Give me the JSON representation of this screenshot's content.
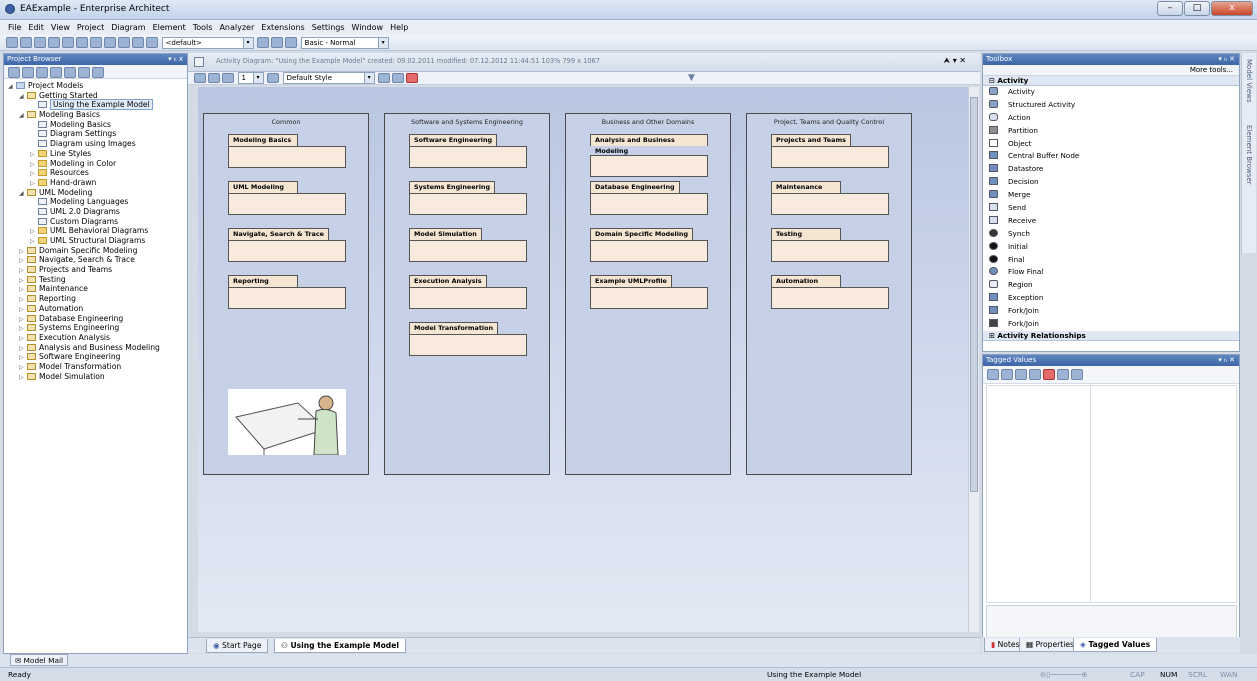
{
  "window": {
    "title": "EAExample - Enterprise Architect",
    "buttons": [
      "–",
      "□",
      "x"
    ]
  },
  "menu": [
    "File",
    "Edit",
    "View",
    "Project",
    "Diagram",
    "Element",
    "Tools",
    "Analyzer",
    "Extensions",
    "Settings",
    "Window",
    "Help"
  ],
  "toolbar": {
    "view_combo": "<default>",
    "workspace_combo": "Basic - Normal"
  },
  "project_browser": {
    "title": "Project Browser",
    "controls": "▾ ₕ x",
    "tree": [
      {
        "label": "Project Models",
        "depth": 0,
        "arrow": "◢",
        "icon": "model"
      },
      {
        "label": "Getting Started",
        "depth": 1,
        "arrow": "◢",
        "icon": "pkg"
      },
      {
        "label": "Using the Example Model",
        "depth": 2,
        "arrow": "",
        "icon": "diag",
        "selected": true
      },
      {
        "label": "Modeling Basics",
        "depth": 1,
        "arrow": "◢",
        "icon": "pkg"
      },
      {
        "label": "Modeling Basics",
        "depth": 2,
        "arrow": "",
        "icon": "diag"
      },
      {
        "label": "Diagram Settings",
        "depth": 2,
        "arrow": "",
        "icon": "diag"
      },
      {
        "label": "Diagram using Images",
        "depth": 2,
        "arrow": "",
        "icon": "diag"
      },
      {
        "label": "Line Styles",
        "depth": 2,
        "arrow": "▷",
        "icon": "folder"
      },
      {
        "label": "Modeling in Color",
        "depth": 2,
        "arrow": "▷",
        "icon": "folder"
      },
      {
        "label": "Resources",
        "depth": 2,
        "arrow": "▷",
        "icon": "folder"
      },
      {
        "label": "Hand-drawn",
        "depth": 2,
        "arrow": "▷",
        "icon": "folder"
      },
      {
        "label": "UML Modeling",
        "depth": 1,
        "arrow": "◢",
        "icon": "pkg"
      },
      {
        "label": "Modeling Languages",
        "depth": 2,
        "arrow": "",
        "icon": "diag"
      },
      {
        "label": "UML 2.0 Diagrams",
        "depth": 2,
        "arrow": "",
        "icon": "diag"
      },
      {
        "label": "Custom Diagrams",
        "depth": 2,
        "arrow": "",
        "icon": "diag"
      },
      {
        "label": "UML Behavioral Diagrams",
        "depth": 2,
        "arrow": "▷",
        "icon": "folder"
      },
      {
        "label": "UML Structural Diagrams",
        "depth": 2,
        "arrow": "▷",
        "icon": "folder"
      },
      {
        "label": "Domain Specific Modeling",
        "depth": 1,
        "arrow": "▷",
        "icon": "pkg"
      },
      {
        "label": "Navigate, Search & Trace",
        "depth": 1,
        "arrow": "▷",
        "icon": "pkg"
      },
      {
        "label": "Projects and Teams",
        "depth": 1,
        "arrow": "▷",
        "icon": "pkg"
      },
      {
        "label": "Testing",
        "depth": 1,
        "arrow": "▷",
        "icon": "pkg"
      },
      {
        "label": "Maintenance",
        "depth": 1,
        "arrow": "▷",
        "icon": "pkg"
      },
      {
        "label": "Reporting",
        "depth": 1,
        "arrow": "▷",
        "icon": "pkg"
      },
      {
        "label": "Automation",
        "depth": 1,
        "arrow": "▷",
        "icon": "pkg"
      },
      {
        "label": "Database Engineering",
        "depth": 1,
        "arrow": "▷",
        "icon": "pkg"
      },
      {
        "label": "Systems Engineering",
        "depth": 1,
        "arrow": "▷",
        "icon": "pkg"
      },
      {
        "label": "Execution Analysis",
        "depth": 1,
        "arrow": "▷",
        "icon": "pkg"
      },
      {
        "label": "Analysis and Business Modeling",
        "depth": 1,
        "arrow": "▷",
        "icon": "pkg"
      },
      {
        "label": "Software Engineering",
        "depth": 1,
        "arrow": "▷",
        "icon": "pkg"
      },
      {
        "label": "Model Transformation",
        "depth": 1,
        "arrow": "▷",
        "icon": "pkg"
      },
      {
        "label": "Model Simulation",
        "depth": 1,
        "arrow": "▷",
        "icon": "pkg"
      }
    ]
  },
  "diagram": {
    "caption": "Activity Diagram: \"Using the Example Model\"  created: 09.02.2011  modified: 07.12.2012 11:44:51  103%  799 x 1067",
    "style_combo": "Default Style",
    "line_width": "1",
    "columns": [
      {
        "title": "Common",
        "packages": [
          "Modeling Basics",
          "UML Modeling",
          "Navigate, Search & Trace",
          "Reporting"
        ]
      },
      {
        "title": "Software and Systems Engineering",
        "packages": [
          "Software Engineering",
          "Systems Engineering",
          "Model Simulation",
          "Execution Analysis",
          "Model Transformation"
        ]
      },
      {
        "title": "Business and Other Domains",
        "packages": [
          "Analysis and Business Modeling",
          "Database Engineering",
          "Domain Specific Modeling",
          "Example UMLProfile"
        ]
      },
      {
        "title": "Project, Teams and Quality Control",
        "packages": [
          "Projects and Teams",
          "Maintenance",
          "Testing",
          "Automation"
        ]
      }
    ],
    "tabs": [
      "Start Page",
      "Using the Example Model"
    ]
  },
  "toolbox": {
    "title": "Toolbox",
    "more": "More tools...",
    "section": "Activity",
    "section2": "Activity Relationships",
    "items": [
      "Activity",
      "Structured Activity",
      "Action",
      "Partition",
      "Object",
      "Central Buffer Node",
      "Datastore",
      "Decision",
      "Merge",
      "Send",
      "Receive",
      "Synch",
      "Initial",
      "Final",
      "Flow Final",
      "Region",
      "Exception",
      "Fork/Join",
      "Fork/Join"
    ]
  },
  "tagged_values": {
    "title": "Tagged Values"
  },
  "bottom_tabs": [
    "Notes",
    "Properties",
    "Tagged Values"
  ],
  "side_dock": [
    "Model Views",
    "Element Browser"
  ],
  "mail": "Model Mail",
  "status": {
    "left": "Ready",
    "center": "Using the Example Model",
    "right": [
      "CAP",
      "NUM",
      "SCRL",
      "WAN"
    ]
  }
}
